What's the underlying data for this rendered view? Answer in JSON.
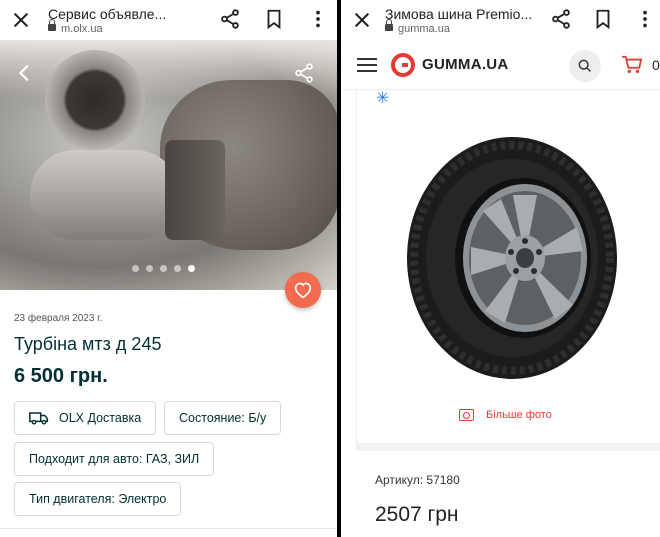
{
  "left": {
    "browser": {
      "title": "Сервис объявле...",
      "domain": "m.olx.ua"
    },
    "gallery": {
      "dots": 5,
      "active_index": 4
    },
    "date": "23 февраля 2023 г.",
    "title": "Турбіна мтз д 245",
    "price": "6 500 грн.",
    "tags": {
      "delivery": "OLX Доставка",
      "condition": "Состояние: Б/у",
      "fits": "Подходит для авто: ГАЗ, ЗИЛ",
      "engine": "Тип двигателя: Электро"
    },
    "colors": {
      "accent": "#f26b4e",
      "text": "#002f34"
    }
  },
  "right": {
    "browser": {
      "title": "Зимова шина Premio...",
      "domain": "gumma.ua"
    },
    "logo_text": "GUMMA.UA",
    "cart_count": "0",
    "more_photos": "Більше фото",
    "article": "Артикул: 57180",
    "price": "2507 грн",
    "colors": {
      "brand": "#e53935"
    }
  }
}
